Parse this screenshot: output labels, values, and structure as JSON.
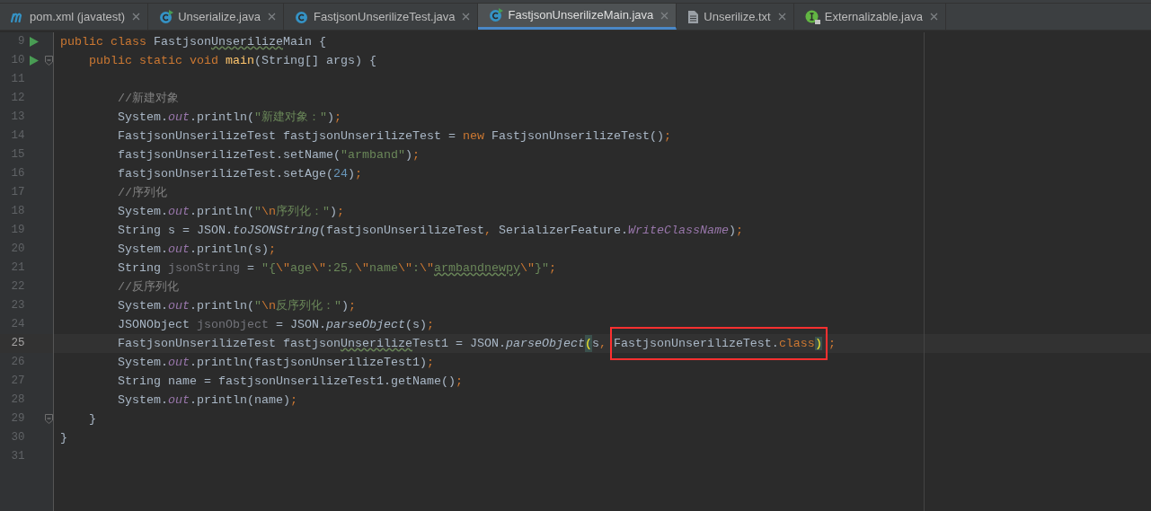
{
  "tabs": [
    {
      "label": "pom.xml (javatest)",
      "kind": "maven",
      "selected": false
    },
    {
      "label": "Unserialize.java",
      "kind": "runnable_class",
      "selected": false
    },
    {
      "label": "FastjsonUnserilizeTest.java",
      "kind": "class",
      "selected": false
    },
    {
      "label": "FastjsonUnserilizeMain.java",
      "kind": "runnable_class",
      "selected": true
    },
    {
      "label": "Unserilize.txt",
      "kind": "text",
      "selected": false
    },
    {
      "label": "Externalizable.java",
      "kind": "interface",
      "selected": false
    }
  ],
  "editor": {
    "lines": [
      {
        "number": "9",
        "kind": "class",
        "run": true,
        "fold": false,
        "selected": false,
        "tokens": [
          {
            "kind": "keyword",
            "text": "public class "
          },
          {
            "kind": "plain",
            "text": "Fastjson"
          },
          {
            "kind": "typo",
            "text": "Unserilize"
          },
          {
            "kind": "plain",
            "text": "Main {"
          }
        ]
      },
      {
        "number": "10",
        "kind": "member",
        "run": true,
        "fold": true,
        "selected": false,
        "tokens": [
          {
            "kind": "keyword",
            "text": "public static void "
          },
          {
            "kind": "method",
            "text": "main"
          },
          {
            "kind": "plain",
            "text": "(String[] args) {"
          }
        ]
      },
      {
        "number": "11",
        "kind": "blank",
        "run": false,
        "fold": false,
        "selected": false
      },
      {
        "number": "12",
        "kind": "statement",
        "run": false,
        "fold": false,
        "selected": false,
        "tokens": [
          {
            "kind": "comment",
            "text": "//新建对象"
          }
        ]
      },
      {
        "number": "13",
        "kind": "statement",
        "run": false,
        "fold": false,
        "selected": false,
        "tokens": [
          {
            "kind": "plain",
            "text": "System."
          },
          {
            "kind": "field",
            "text": "out"
          },
          {
            "kind": "plain",
            "text": ".println("
          },
          {
            "kind": "string",
            "text": "\"新建对象：\""
          },
          {
            "kind": "plain",
            "text": ")"
          },
          {
            "kind": "keyword",
            "text": ";"
          }
        ]
      },
      {
        "number": "14",
        "kind": "statement",
        "run": false,
        "fold": false,
        "selected": false,
        "tokens": [
          {
            "kind": "plain",
            "text": "FastjsonUnserilizeTest fastjsonUnserilizeTest = "
          },
          {
            "kind": "keyword",
            "text": "new"
          },
          {
            "kind": "plain",
            "text": " FastjsonUnserilizeTest()"
          },
          {
            "kind": "keyword",
            "text": ";"
          }
        ]
      },
      {
        "number": "15",
        "kind": "statement",
        "run": false,
        "fold": false,
        "selected": false,
        "tokens": [
          {
            "kind": "plain",
            "text": "fastjsonUnserilizeTest.setName("
          },
          {
            "kind": "string",
            "text": "\"armband\""
          },
          {
            "kind": "plain",
            "text": ")"
          },
          {
            "kind": "keyword",
            "text": ";"
          }
        ]
      },
      {
        "number": "16",
        "kind": "statement",
        "run": false,
        "fold": false,
        "selected": false,
        "tokens": [
          {
            "kind": "plain",
            "text": "fastjsonUnserilizeTest.setAge("
          },
          {
            "kind": "number",
            "text": "24"
          },
          {
            "kind": "plain",
            "text": ")"
          },
          {
            "kind": "keyword",
            "text": ";"
          }
        ]
      },
      {
        "number": "17",
        "kind": "statement",
        "run": false,
        "fold": false,
        "selected": false,
        "tokens": [
          {
            "kind": "comment",
            "text": "//序列化"
          }
        ]
      },
      {
        "number": "18",
        "kind": "statement",
        "run": false,
        "fold": false,
        "selected": false,
        "tokens": [
          {
            "kind": "plain",
            "text": "System."
          },
          {
            "kind": "field",
            "text": "out"
          },
          {
            "kind": "plain",
            "text": ".println("
          },
          {
            "kind": "string",
            "text": "\""
          },
          {
            "kind": "escape",
            "text": "\\n"
          },
          {
            "kind": "string",
            "text": "序列化：\""
          },
          {
            "kind": "plain",
            "text": ")"
          },
          {
            "kind": "keyword",
            "text": ";"
          }
        ]
      },
      {
        "number": "19",
        "kind": "statement",
        "run": false,
        "fold": false,
        "selected": false,
        "tokens": [
          {
            "kind": "plain",
            "text": "String s = JSON."
          },
          {
            "kind": "static_method",
            "text": "toJSONString"
          },
          {
            "kind": "plain",
            "text": "(fastjsonUnserilizeTest"
          },
          {
            "kind": "keyword",
            "text": ", "
          },
          {
            "kind": "plain",
            "text": "SerializerFeature."
          },
          {
            "kind": "field",
            "text": "WriteClassName"
          },
          {
            "kind": "plain",
            "text": ")"
          },
          {
            "kind": "keyword",
            "text": ";"
          }
        ]
      },
      {
        "number": "20",
        "kind": "statement",
        "run": false,
        "fold": false,
        "selected": false,
        "tokens": [
          {
            "kind": "plain",
            "text": "System."
          },
          {
            "kind": "field",
            "text": "out"
          },
          {
            "kind": "plain",
            "text": ".println(s)"
          },
          {
            "kind": "keyword",
            "text": ";"
          }
        ]
      },
      {
        "number": "21",
        "kind": "statement",
        "run": false,
        "fold": false,
        "selected": false,
        "tokens": [
          {
            "kind": "plain",
            "text": "String "
          },
          {
            "kind": "unused",
            "text": "jsonString"
          },
          {
            "kind": "plain",
            "text": " = "
          },
          {
            "kind": "string",
            "text": "\"{"
          },
          {
            "kind": "escape",
            "text": "\\\""
          },
          {
            "kind": "string",
            "text": "age"
          },
          {
            "kind": "escape",
            "text": "\\\""
          },
          {
            "kind": "string",
            "text": ":25,"
          },
          {
            "kind": "escape",
            "text": "\\\""
          },
          {
            "kind": "string",
            "text": "name"
          },
          {
            "kind": "escape",
            "text": "\\\""
          },
          {
            "kind": "string",
            "text": ":"
          },
          {
            "kind": "escape",
            "text": "\\\""
          },
          {
            "kind": "typo_string",
            "text": "armbandnewpy"
          },
          {
            "kind": "escape",
            "text": "\\\""
          },
          {
            "kind": "string",
            "text": "}\""
          },
          {
            "kind": "keyword",
            "text": ";"
          }
        ]
      },
      {
        "number": "22",
        "kind": "statement",
        "run": false,
        "fold": false,
        "selected": false,
        "tokens": [
          {
            "kind": "comment",
            "text": "//反序列化"
          }
        ]
      },
      {
        "number": "23",
        "kind": "statement",
        "run": false,
        "fold": false,
        "selected": false,
        "tokens": [
          {
            "kind": "plain",
            "text": "System."
          },
          {
            "kind": "field",
            "text": "out"
          },
          {
            "kind": "plain",
            "text": ".println("
          },
          {
            "kind": "string",
            "text": "\""
          },
          {
            "kind": "escape",
            "text": "\\n"
          },
          {
            "kind": "string",
            "text": "反序列化：\""
          },
          {
            "kind": "plain",
            "text": ")"
          },
          {
            "kind": "keyword",
            "text": ";"
          }
        ]
      },
      {
        "number": "24",
        "kind": "statement",
        "run": false,
        "fold": false,
        "selected": false,
        "tokens": [
          {
            "kind": "plain",
            "text": "JSONObject "
          },
          {
            "kind": "unused",
            "text": "jsonObject"
          },
          {
            "kind": "plain",
            "text": " = JSON."
          },
          {
            "kind": "static_method",
            "text": "parseObject"
          },
          {
            "kind": "plain",
            "text": "(s)"
          },
          {
            "kind": "keyword",
            "text": ";"
          }
        ]
      },
      {
        "number": "25",
        "kind": "statement",
        "run": false,
        "fold": false,
        "selected": true,
        "tokens": [
          {
            "kind": "plain",
            "text": "FastjsonUnserilizeTest fastjson"
          },
          {
            "kind": "typo",
            "text": "Unserilize"
          },
          {
            "kind": "plain",
            "text": "Test1 = JSON."
          },
          {
            "kind": "static_method",
            "text": "parseObject"
          },
          {
            "kind": "brace_match",
            "text": "("
          },
          {
            "kind": "plain",
            "text": "s"
          },
          {
            "kind": "keyword",
            "text": ", "
          },
          {
            "kind": "box",
            "tokens": [
              {
                "kind": "plain",
                "text": "FastjsonUnserilizeTest."
              },
              {
                "kind": "keyword",
                "text": "class"
              },
              {
                "kind": "brace_match",
                "text": ")"
              }
            ]
          },
          {
            "kind": "keyword",
            "text": ";"
          }
        ]
      },
      {
        "number": "26",
        "kind": "statement",
        "run": false,
        "fold": false,
        "selected": false,
        "tokens": [
          {
            "kind": "plain",
            "text": "System."
          },
          {
            "kind": "field",
            "text": "out"
          },
          {
            "kind": "plain",
            "text": ".println(fastjsonUnserilizeTest1)"
          },
          {
            "kind": "keyword",
            "text": ";"
          }
        ]
      },
      {
        "number": "27",
        "kind": "statement",
        "run": false,
        "fold": false,
        "selected": false,
        "tokens": [
          {
            "kind": "plain",
            "text": "String name = fastjsonUnserilizeTest1.getName()"
          },
          {
            "kind": "keyword",
            "text": ";"
          }
        ]
      },
      {
        "number": "28",
        "kind": "statement",
        "run": false,
        "fold": false,
        "selected": false,
        "tokens": [
          {
            "kind": "plain",
            "text": "System."
          },
          {
            "kind": "field",
            "text": "out"
          },
          {
            "kind": "plain",
            "text": ".println(name)"
          },
          {
            "kind": "keyword",
            "text": ";"
          }
        ]
      },
      {
        "number": "29",
        "kind": "member",
        "run": false,
        "fold": true,
        "selected": false,
        "tokens": [
          {
            "kind": "plain",
            "text": "}"
          }
        ]
      },
      {
        "number": "30",
        "kind": "class",
        "run": false,
        "fold": false,
        "selected": false,
        "tokens": [
          {
            "kind": "plain",
            "text": "}"
          }
        ]
      },
      {
        "number": "31",
        "kind": "blank",
        "run": false,
        "fold": false,
        "selected": false
      }
    ]
  }
}
